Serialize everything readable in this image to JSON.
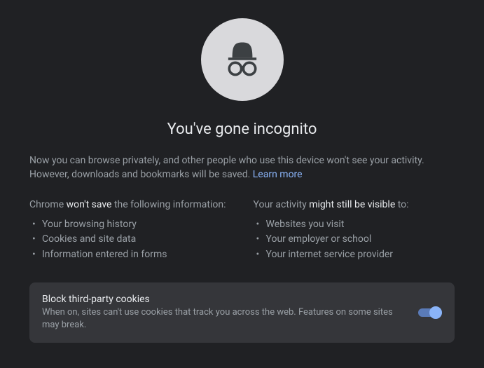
{
  "title": "You've gone incognito",
  "intro": {
    "text_before": "Now you can browse privately, and other people who use this device won't see your activity. However, downloads and bookmarks will be saved. ",
    "learn_more": "Learn more"
  },
  "left": {
    "head_before": "Chrome ",
    "head_em": "won't save",
    "head_after": " the following information:",
    "items": [
      "Your browsing history",
      "Cookies and site data",
      "Information entered in forms"
    ]
  },
  "right": {
    "head_before": "Your activity ",
    "head_em": "might still be visible",
    "head_after": " to:",
    "items": [
      "Websites you visit",
      "Your employer or school",
      "Your internet service provider"
    ]
  },
  "card": {
    "title": "Block third-party cookies",
    "desc": "When on, sites can't use cookies that track you across the web. Features on some sites may break.",
    "toggle_on": true
  }
}
